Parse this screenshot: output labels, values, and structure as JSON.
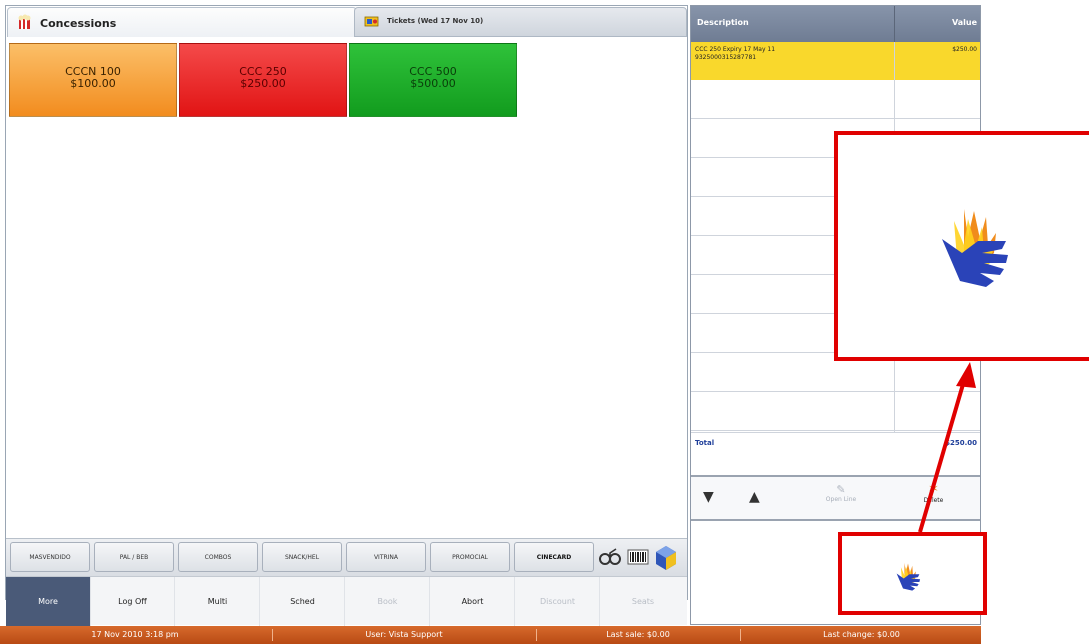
{
  "tabs": {
    "concessions_label": "Concessions",
    "tickets_label": "Tickets (Wed 17 Nov 10)"
  },
  "tiles": [
    {
      "name": "CCCN 100",
      "price": "$100.00",
      "color": "#f28c1e"
    },
    {
      "name": "CCC 250",
      "price": "$250.00",
      "color": "#e11414"
    },
    {
      "name": "CCC 500",
      "price": "$500.00",
      "color": "#129c1e"
    }
  ],
  "categories": [
    "MASVENDIDO",
    "PAL / BEB",
    "COMBOS",
    "SNACK/HEL",
    "VITRINA",
    "PROMOCIAL",
    "CINECARD"
  ],
  "category_icons": [
    "glasses-icon",
    "barcode-icon",
    "cube-icon"
  ],
  "functions": [
    {
      "label": "More",
      "enabled": true
    },
    {
      "label": "Log Off",
      "enabled": true
    },
    {
      "label": "Multi",
      "enabled": true
    },
    {
      "label": "Sched",
      "enabled": true
    },
    {
      "label": "Book",
      "enabled": false
    },
    {
      "label": "Abort",
      "enabled": true
    },
    {
      "label": "Discount",
      "enabled": false
    },
    {
      "label": "Seats",
      "enabled": false
    }
  ],
  "order": {
    "header_description": "Description",
    "header_value": "Value",
    "items": [
      {
        "line1": "CCC 250  Expiry 17 May 11",
        "line2": "9325000315287781",
        "value": "$250.00"
      }
    ],
    "total_label": "Total",
    "total_value": "$250.00",
    "open_line_label": "Open Line",
    "delete_label": "Delete"
  },
  "status": {
    "date": "17 Nov 2010 3:18 pm",
    "user": "User:  Vista  Support",
    "last_sale": "Last sale:  $0.00",
    "last_change": "Last change:  $0.00"
  },
  "colors": {
    "accent": "#4a5a78",
    "highlight": "#f9d82c",
    "status_bar": "#c75a1f",
    "annotation": "#e00000"
  }
}
